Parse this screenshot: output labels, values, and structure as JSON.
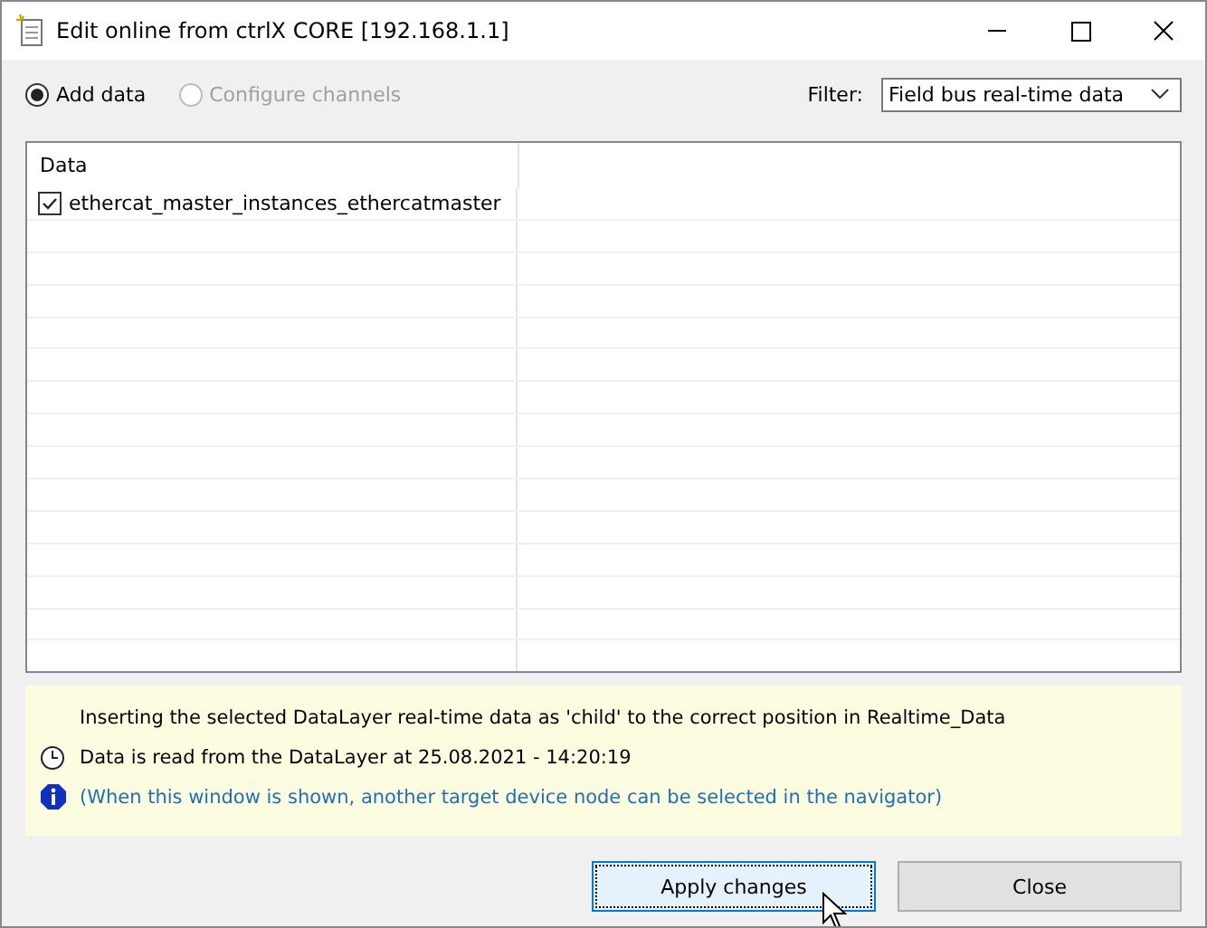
{
  "window": {
    "title": "Edit online from ctrlX CORE [192.168.1.1]"
  },
  "modes": [
    {
      "label": "Add data",
      "selected": true,
      "disabled": false
    },
    {
      "label": "Configure channels",
      "selected": false,
      "disabled": true
    }
  ],
  "filter": {
    "label": "Filter:",
    "value": "Field bus real-time data"
  },
  "table": {
    "columns": [
      "Data"
    ],
    "rows": [
      {
        "name": "ethercat_master_instances_ethercatmaster",
        "checked": true
      }
    ]
  },
  "messages": [
    {
      "kind": "text",
      "text": "Inserting the selected DataLayer real-time data as 'child' to the correct position in Realtime_Data"
    },
    {
      "kind": "time",
      "text": "Data is read from the DataLayer at  25.08.2021 - 14:20:19"
    },
    {
      "kind": "info",
      "text": "(When this window is shown, another target device node can be selected in the navigator)"
    }
  ],
  "buttons": [
    {
      "label": "Apply changes",
      "focused": true
    },
    {
      "label": "Close",
      "focused": false
    }
  ]
}
